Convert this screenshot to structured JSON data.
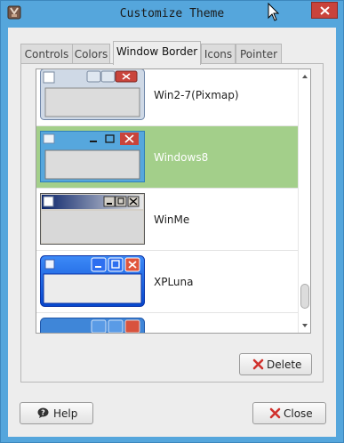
{
  "window": {
    "title": "Customize Theme",
    "titlebar_color": "#55a6dc",
    "close_button_color": "#c9433b"
  },
  "tabs": [
    {
      "label": "Controls",
      "active": false
    },
    {
      "label": "Colors",
      "active": false
    },
    {
      "label": "Window Border",
      "active": true
    },
    {
      "label": "Icons",
      "active": false
    },
    {
      "label": "Pointer",
      "active": false
    }
  ],
  "theme_list": {
    "items": [
      {
        "label": "Win2-7(Pixmap)",
        "selected": false
      },
      {
        "label": "Windows8",
        "selected": true
      },
      {
        "label": "WinMe",
        "selected": false
      },
      {
        "label": "XPLuna",
        "selected": false
      }
    ],
    "selection_color": "#a3cf8a"
  },
  "buttons": {
    "delete_label": "Delete",
    "help_label": "Help",
    "close_label": "Close"
  },
  "icons": {
    "app": "theme-icon",
    "cursor": "mouse-pointer-icon",
    "delete": "red-x-icon",
    "help": "help-bubble-icon",
    "close": "red-x-icon"
  }
}
